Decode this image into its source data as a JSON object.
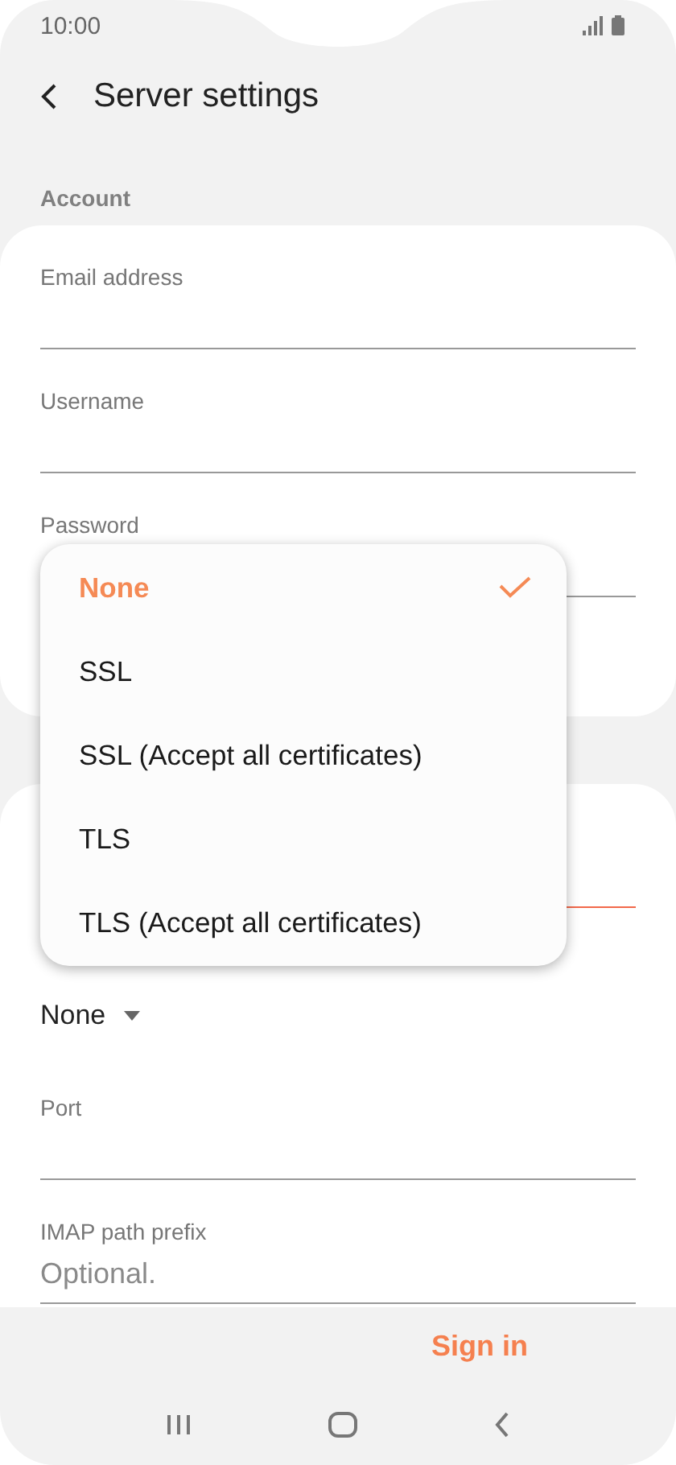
{
  "status_bar": {
    "time": "10:00"
  },
  "header": {
    "title": "Server settings"
  },
  "account": {
    "title": "Account",
    "fields": [
      {
        "label": "Email address"
      },
      {
        "label": "Username"
      },
      {
        "label": "Password"
      }
    ]
  },
  "server": {
    "fields": [
      {
        "kind": "text",
        "focused": true
      },
      {
        "kind": "dropdown",
        "value": "None"
      },
      {
        "kind": "text",
        "label": "Port",
        "focused": false
      },
      {
        "kind": "text",
        "label": "IMAP path prefix",
        "placeholder": "Optional.",
        "focused": false
      }
    ]
  },
  "menu": {
    "options": [
      {
        "label": "None",
        "selected": true
      },
      {
        "label": "SSL",
        "selected": false
      },
      {
        "label": "SSL (Accept all certificates)",
        "selected": false
      },
      {
        "label": "TLS",
        "selected": false
      },
      {
        "label": "TLS (Accept all certificates)",
        "selected": false
      }
    ]
  },
  "footer": {
    "action": "Sign in"
  }
}
